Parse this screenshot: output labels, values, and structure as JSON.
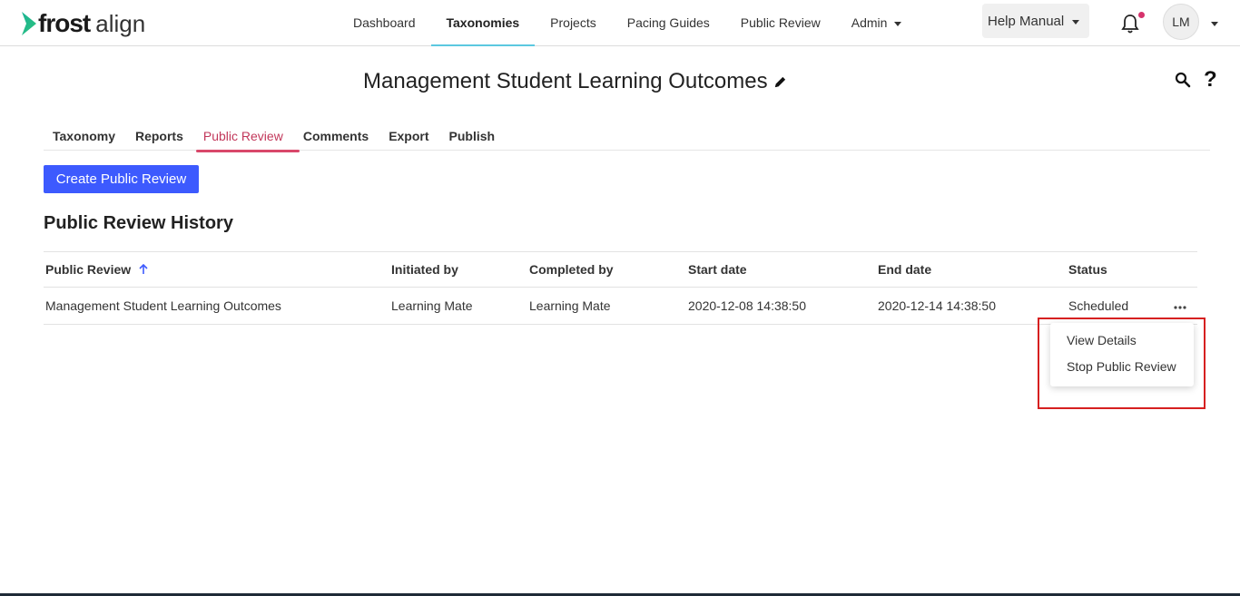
{
  "brand": {
    "name_bold": "frost",
    "name_light": "align"
  },
  "nav": {
    "links": [
      "Dashboard",
      "Taxonomies",
      "Projects",
      "Pacing Guides",
      "Public Review",
      "Admin"
    ],
    "active": "Taxonomies",
    "help_label": "Help Manual",
    "avatar_initials": "LM"
  },
  "page": {
    "title": "Management Student Learning Outcomes",
    "tabs": [
      "Taxonomy",
      "Reports",
      "Public Review",
      "Comments",
      "Export",
      "Publish"
    ],
    "active_tab": "Public Review",
    "create_button": "Create Public Review",
    "section_title": "Public Review History",
    "help_glyph": "?"
  },
  "table": {
    "headers": [
      "Public Review",
      "Initiated by",
      "Completed by",
      "Start date",
      "End date",
      "Status"
    ],
    "rows": [
      [
        "Management Student Learning Outcomes",
        "Learning Mate",
        "Learning Mate",
        "2020-12-08 14:38:50",
        "2020-12-14 14:38:50",
        "Scheduled"
      ]
    ]
  },
  "menu": {
    "items": [
      "View Details",
      "Stop Public Review"
    ]
  },
  "colors": {
    "primary": "#3d5afe",
    "tab_active": "#c2375a",
    "nav_underline": "#5bc8e0",
    "highlight": "#d62020",
    "logo_green": "#2ec27e"
  }
}
